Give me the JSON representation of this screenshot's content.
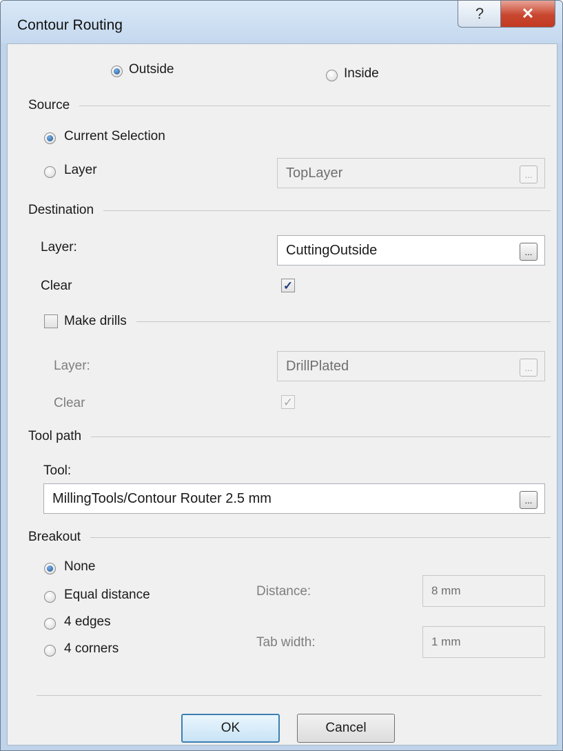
{
  "window": {
    "title": "Contour Routing",
    "help_glyph": "?",
    "close_glyph": "✕"
  },
  "mode": {
    "outside": "Outside",
    "inside": "Inside",
    "selected": "Outside"
  },
  "source": {
    "heading": "Source",
    "current_selection": "Current Selection",
    "layer": "Layer",
    "selected": "Current Selection",
    "layer_value": "TopLayer"
  },
  "destination": {
    "heading": "Destination",
    "layer_label": "Layer:",
    "layer_value": "CuttingOutside",
    "clear_label": "Clear",
    "clear_checked": true
  },
  "drills": {
    "heading": "Make drills",
    "enabled": false,
    "layer_label": "Layer:",
    "layer_value": "DrillPlated",
    "clear_label": "Clear",
    "clear_checked": true
  },
  "toolpath": {
    "heading": "Tool path",
    "tool_label": "Tool:",
    "tool_value": "MillingTools/Contour Router 2.5 mm"
  },
  "breakout": {
    "heading": "Breakout",
    "options": [
      "None",
      "Equal distance",
      "4 edges",
      "4 corners"
    ],
    "selected": "None",
    "distance_label": "Distance:",
    "distance_value": "8 mm",
    "tab_width_label": "Tab width:",
    "tab_width_value": "1 mm"
  },
  "browse_glyph": "...",
  "buttons": {
    "ok": "OK",
    "cancel": "Cancel"
  }
}
